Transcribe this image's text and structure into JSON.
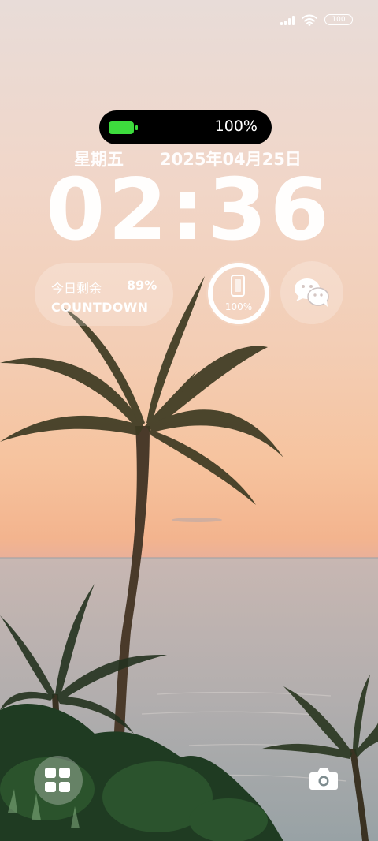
{
  "status_bar": {
    "battery_label": "100",
    "icons": [
      "signal-icon",
      "wifi-icon",
      "battery-icon"
    ]
  },
  "dynamic_island": {
    "battery_percent": "100%",
    "battery_level": 1.0,
    "battery_color": "#3ddc3d"
  },
  "lockscreen": {
    "weekday": "星期五",
    "date": "2025年04月25日",
    "time": "02:36"
  },
  "widgets": {
    "countdown": {
      "title": "今日剩余",
      "percent": "89%",
      "label": "COUNTDOWN"
    },
    "battery_ring": {
      "percent": "100%",
      "level": 1.0,
      "icon": "phone-icon"
    },
    "wechat": {
      "icon": "wechat-icon"
    }
  },
  "controls": {
    "left_icon": "grid-icon",
    "right_icon": "camera-icon"
  }
}
